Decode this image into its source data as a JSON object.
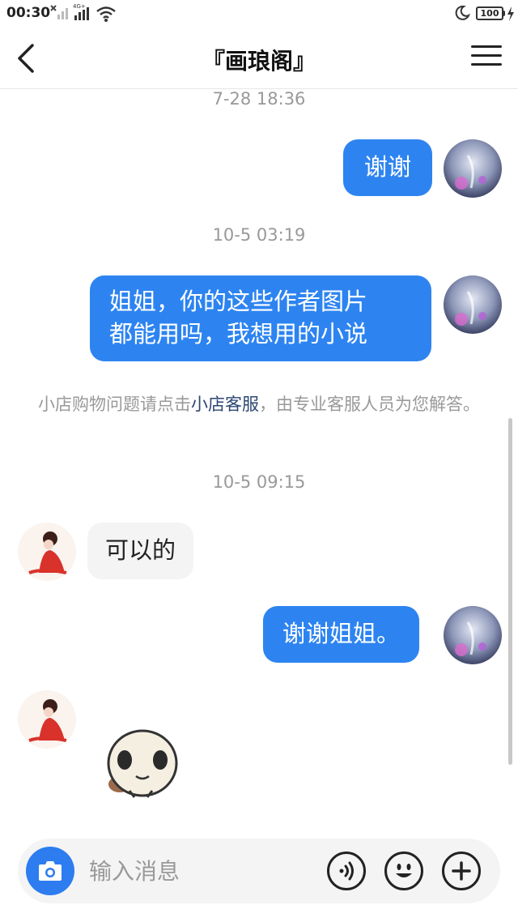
{
  "status_bar": {
    "time": "00:30",
    "battery": "100"
  },
  "header": {
    "title": "『画琅阁』"
  },
  "timestamps": [
    "7-28 18:36",
    "10-5 03:19",
    "10-5 09:15"
  ],
  "messages": [
    {
      "direction": "out",
      "text": "谢谢"
    },
    {
      "direction": "out",
      "lines": [
        "姐姐，你的这些作者图片",
        "都能用吗，我想用的小说"
      ]
    },
    {
      "direction": "in",
      "text": "可以的"
    },
    {
      "direction": "out",
      "text": "谢谢姐姐。"
    },
    {
      "direction": "in",
      "sticker": "panda-sticker"
    }
  ],
  "system_notice": {
    "before": "小店购物问题请点击",
    "link": "小店客服",
    "after": "，由专业客服人员为您解答。"
  },
  "input": {
    "placeholder": "输入消息"
  },
  "colors": {
    "accent": "#2d84f1",
    "camera": "#2d7cf0",
    "incoming_bubble": "#f4f4f4",
    "notice_link": "#2c4672"
  },
  "icons": [
    "back-icon",
    "menu-icon",
    "camera-icon",
    "voice-icon",
    "emoji-icon",
    "plus-icon"
  ]
}
